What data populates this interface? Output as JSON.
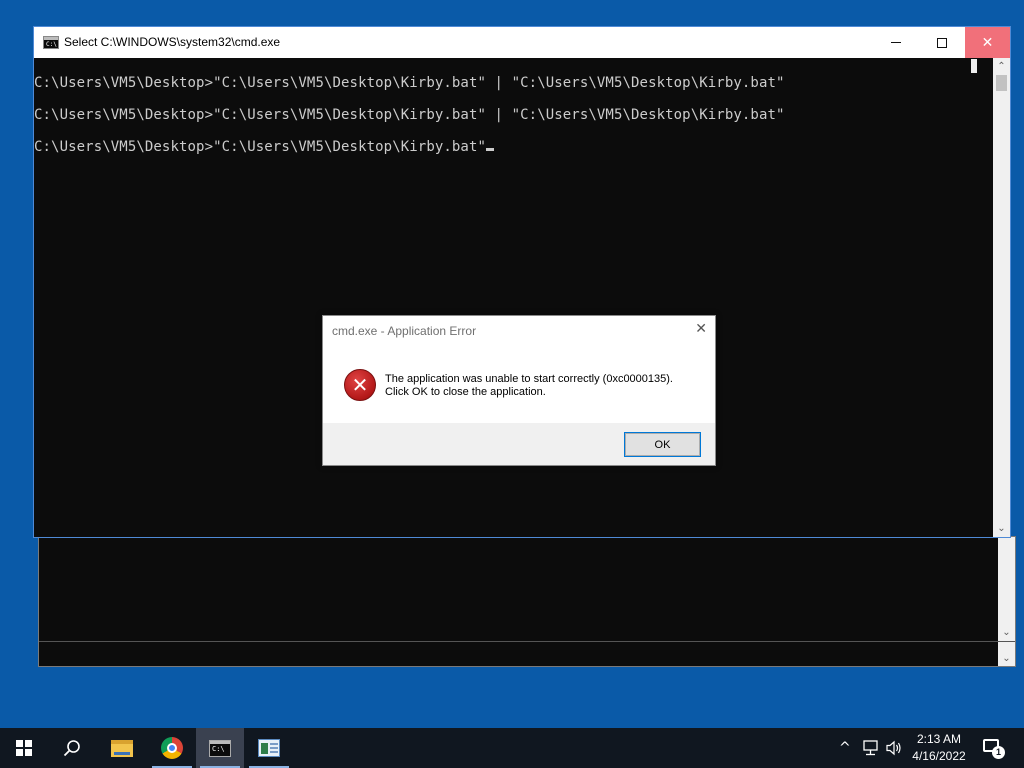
{
  "cmd_window": {
    "title": "Select C:\\WINDOWS\\system32\\cmd.exe",
    "icon_prompt": "C:\\",
    "console_lines": [
      "C:\\Users\\VM5\\Desktop>\"C:\\Users\\VM5\\Desktop\\Kirby.bat\" | \"C:\\Users\\VM5\\Desktop\\Kirby.bat\"",
      "C:\\Users\\VM5\\Desktop>\"C:\\Users\\VM5\\Desktop\\Kirby.bat\" | \"C:\\Users\\VM5\\Desktop\\Kirby.bat\"",
      "C:\\Users\\VM5\\Desktop>\"C:\\Users\\VM5\\Desktop\\Kirby.bat\""
    ],
    "close_glyph": "✕"
  },
  "dialog": {
    "title": "cmd.exe - Application Error",
    "close_glyph": "✕",
    "message_line1": "The application was unable to start correctly (0xc0000135).",
    "message_line2": "Click OK to close the application.",
    "ok_label": "OK",
    "icon": "error-x-icon"
  },
  "taskbar": {
    "time": "2:13 AM",
    "date": "4/16/2022",
    "notification_count": "1",
    "tray_chevron": "^",
    "apps": [
      "start",
      "search",
      "file-explorer",
      "chrome",
      "cmd",
      "app"
    ]
  },
  "colors": {
    "desktop": "#0a5aa8",
    "close_button": "#f1707a",
    "console_bg": "#0c0c0c",
    "console_text": "#cccccc",
    "taskbar": "#101720"
  }
}
